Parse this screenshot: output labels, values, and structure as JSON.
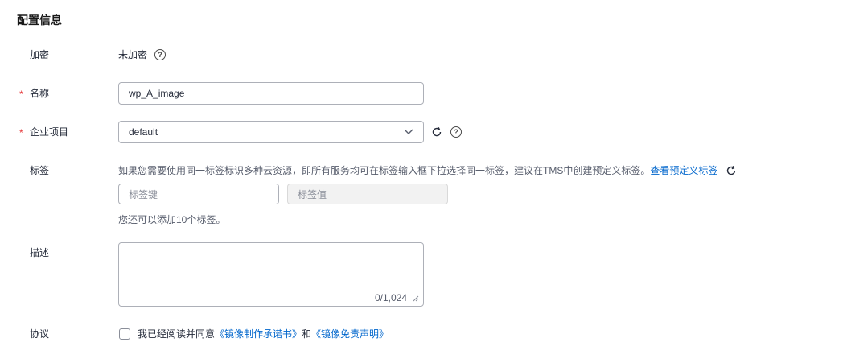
{
  "section": {
    "title": "配置信息"
  },
  "encryption": {
    "label": "加密",
    "value": "未加密",
    "help_icon": "question-circle-icon"
  },
  "name": {
    "label": "名称",
    "required_mark": "*",
    "value": "wp_A_image"
  },
  "enterprise_project": {
    "label": "企业项目",
    "required_mark": "*",
    "selected": "default",
    "icons": [
      "chevron-down-icon",
      "refresh-icon",
      "question-circle-icon"
    ]
  },
  "tags": {
    "label": "标签",
    "hint": "如果您需要使用同一标签标识多种云资源，即所有服务均可在标签输入框下拉选择同一标签，建议在TMS中创建预定义标签。",
    "hint_link": "查看预定义标签",
    "key_placeholder": "标签键",
    "value_placeholder": "标签值",
    "remaining_text": "您还可以添加10个标签。"
  },
  "description": {
    "label": "描述",
    "value": "",
    "counter": "0/1,024"
  },
  "agreement": {
    "label": "协议",
    "checked": false,
    "text_prefix": "我已经阅读并同意",
    "link1": "《镜像制作承诺书》",
    "conjunction": "和",
    "link2": "《镜像免责声明》"
  },
  "colors": {
    "required": "#e6383a",
    "link": "#0066cc",
    "border": "#adb0b8",
    "disabled_bg": "#f2f2f2"
  }
}
